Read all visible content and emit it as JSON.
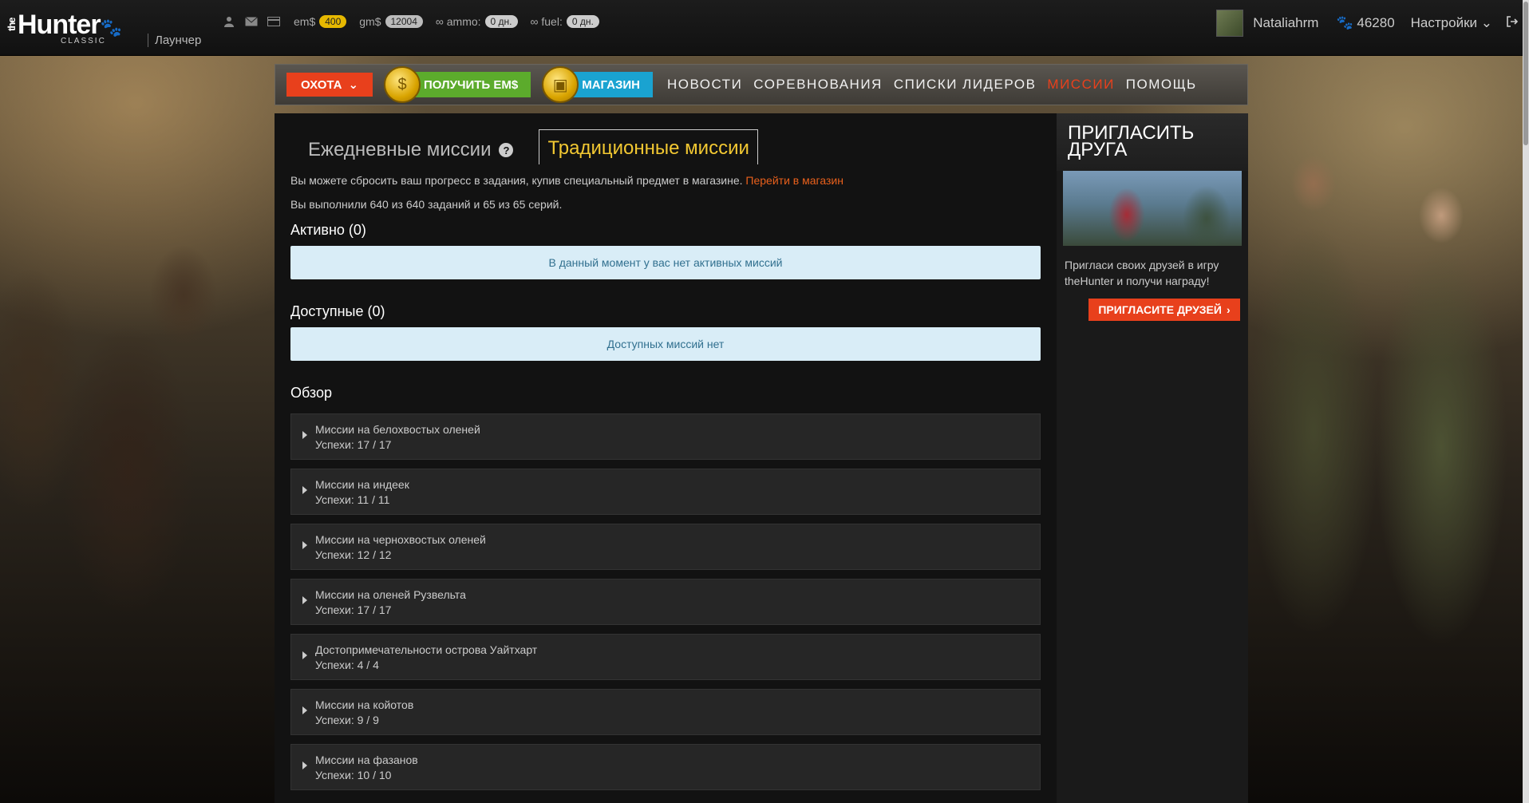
{
  "topbar": {
    "logo_main": "Hunter",
    "logo_the": "the",
    "logo_sub": "CLASSIC",
    "launcher": "Лаунчер",
    "ems_label": "em$",
    "ems_value": "400",
    "gms_label": "gm$",
    "gms_value": "12004",
    "ammo_label": "∞ ammo:",
    "ammo_value": "0 дн.",
    "fuel_label": "∞ fuel:",
    "fuel_value": "0 дн.",
    "username": "Nataliahrm",
    "paw_points": "46280",
    "settings": "Настройки"
  },
  "nav": {
    "hunt": "ОХОТА",
    "get_ems": "ПОЛУЧИТЬ EM$",
    "shop": "МАГАЗИН",
    "links": [
      "НОВОСТИ",
      "СОРЕВНОВАНИЯ",
      "СПИСКИ ЛИДЕРОВ",
      "МИССИИ",
      "ПОМОЩЬ"
    ],
    "active_link": "МИССИИ"
  },
  "main": {
    "tab_daily": "Ежедневные миссии",
    "tab_traditional": "Традиционные миссии",
    "reset_info": "Вы можете сбросить ваш прогресс в задания, купив специальный предмет в магазине.",
    "reset_link": "Перейти в магазин",
    "completed_info": "Вы выполнили 640 из 640 заданий и 65 из 65 серий.",
    "active_title": "Активно (0)",
    "active_empty": "В данный момент у вас нет активных миссий",
    "available_title": "Доступные (0)",
    "available_empty": "Доступных миссий нет",
    "overview_title": "Обзор",
    "missions": [
      {
        "name": "Миссии на белохвостых оленей",
        "progress": "Успехи: 17 / 17"
      },
      {
        "name": "Миссии на индеек",
        "progress": "Успехи: 11 / 11"
      },
      {
        "name": "Миссии на чернохвостых оленей",
        "progress": "Успехи: 12 / 12"
      },
      {
        "name": "Миссии на оленей Рузвельта",
        "progress": "Успехи: 17 / 17"
      },
      {
        "name": "Достопримечательности острова Уайтхарт",
        "progress": "Успехи: 4 / 4"
      },
      {
        "name": "Миссии на койотов",
        "progress": "Успехи: 9 / 9"
      },
      {
        "name": "Миссии на фазанов",
        "progress": "Успехи: 10 / 10"
      }
    ]
  },
  "invite": {
    "title": "ПРИГЛАСИТЬ ДРУГА",
    "text": "Пригласи своих друзей в игру theHunter и получи награду!",
    "button": "ПРИГЛАСИТЕ ДРУЗЕЙ"
  },
  "colors": {
    "accent_red": "#e8401c",
    "green": "#5cab2c",
    "blue": "#1aa3d1",
    "tab_gold": "#f2c832"
  }
}
